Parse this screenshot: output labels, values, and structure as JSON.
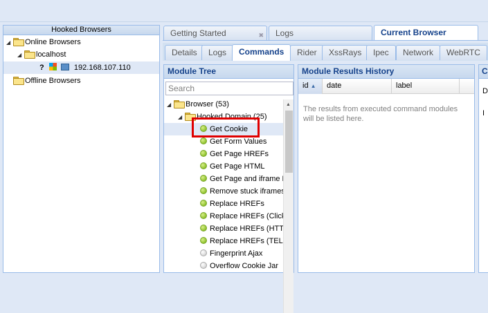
{
  "left_panel": {
    "title": "Hooked Browsers",
    "online": "Online Browsers",
    "host": "localhost",
    "ip": "192.168.107.110",
    "offline": "Offline Browsers",
    "question_mark": "?"
  },
  "tabs": [
    "Getting Started",
    "Logs",
    "Current Browser"
  ],
  "subtabs": [
    "Details",
    "Logs",
    "Commands",
    "Rider",
    "XssRays",
    "Ipec",
    "Network",
    "WebRTC"
  ],
  "module_tree": {
    "title": "Module Tree",
    "search_placeholder": "Search",
    "category": "Browser (53)",
    "subcategory": "Hooked Domain (25)",
    "modules": [
      {
        "label": "Get Cookie",
        "status": "green"
      },
      {
        "label": "Get Form Values",
        "status": "green"
      },
      {
        "label": "Get Page HREFs",
        "status": "green"
      },
      {
        "label": "Get Page HTML",
        "status": "green"
      },
      {
        "label": "Get Page and iframe HTML",
        "status": "green"
      },
      {
        "label": "Remove stuck iframes",
        "status": "green"
      },
      {
        "label": "Replace HREFs",
        "status": "green"
      },
      {
        "label": "Replace HREFs (Click Events)",
        "status": "green"
      },
      {
        "label": "Replace HREFs (HTTPS)",
        "status": "green"
      },
      {
        "label": "Replace HREFs (TEL)",
        "status": "green"
      },
      {
        "label": "Fingerprint Ajax",
        "status": "grey"
      },
      {
        "label": "Overflow Cookie Jar",
        "status": "grey"
      }
    ]
  },
  "results": {
    "title": "Module Results History",
    "columns": [
      "id",
      "date",
      "label"
    ],
    "empty_text": "The results from executed command modules will be listed here."
  },
  "far_panel": {
    "header": "C",
    "line1": "D",
    "line2": "I"
  }
}
